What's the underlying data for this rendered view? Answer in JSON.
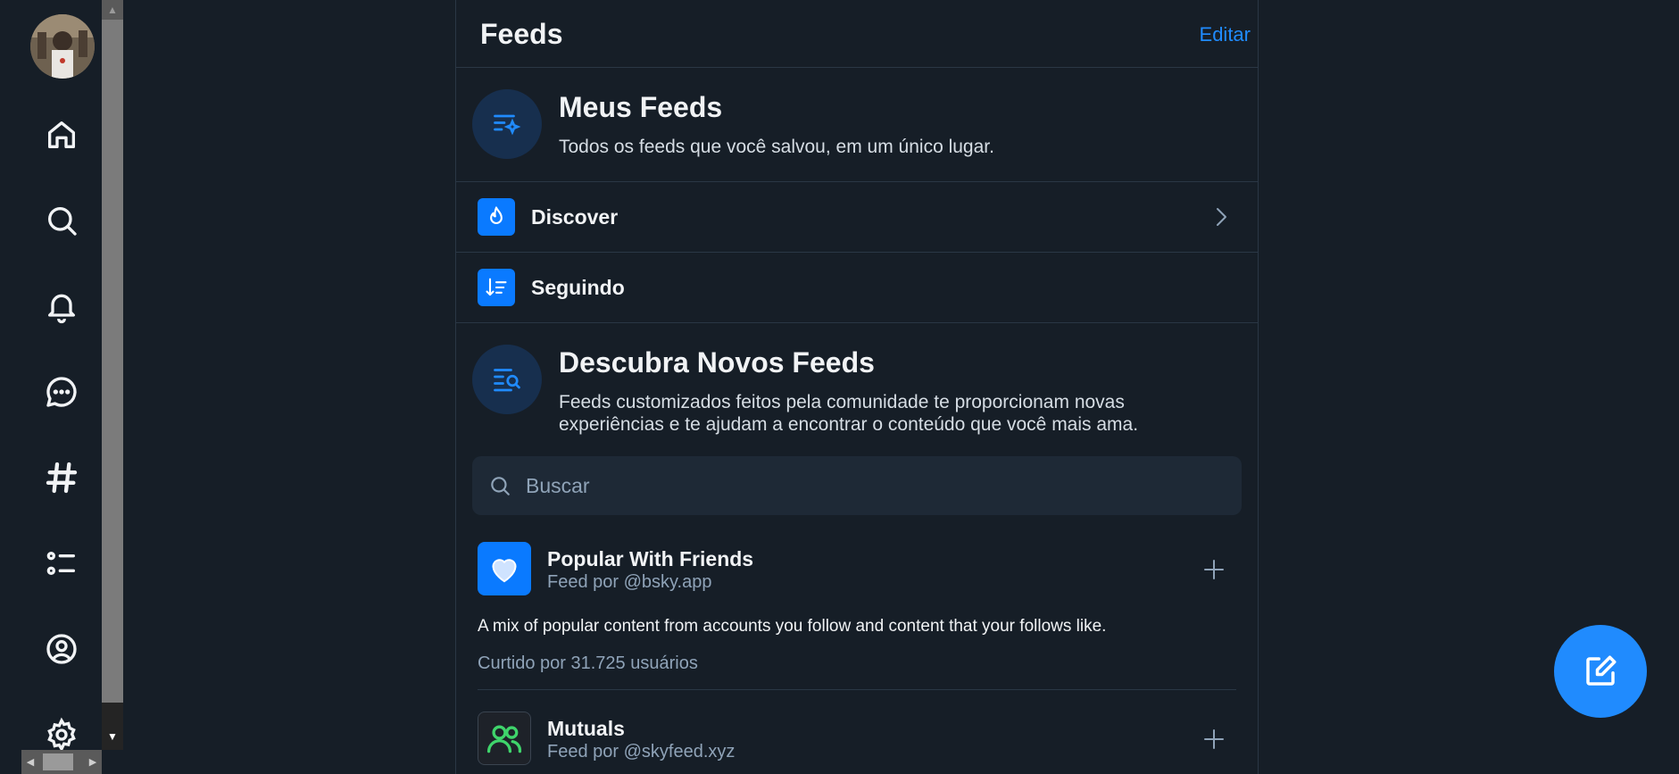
{
  "nav": {
    "items": [
      {
        "name": "home-icon"
      },
      {
        "name": "search-icon"
      },
      {
        "name": "bell-icon"
      },
      {
        "name": "chat-icon"
      },
      {
        "name": "hashtag-icon"
      },
      {
        "name": "list-icon"
      },
      {
        "name": "profile-icon"
      },
      {
        "name": "gear-icon"
      }
    ]
  },
  "header": {
    "title": "Feeds",
    "edit_label": "Editar"
  },
  "my_feeds": {
    "title": "Meus Feeds",
    "description": "Todos os feeds que você salvou, em um único lugar.",
    "rows": [
      {
        "label": "Discover",
        "icon": "flame-icon"
      },
      {
        "label": "Seguindo",
        "icon": "sort-list-icon"
      }
    ]
  },
  "discover": {
    "title": "Descubra Novos Feeds",
    "description_line1": "Feeds customizados feitos pela comunidade te proporcionam novas",
    "description_line2": "experiências e te ajudam a encontrar o conteúdo que você mais ama."
  },
  "search": {
    "placeholder": "Buscar"
  },
  "feeds": [
    {
      "name": "Popular With Friends",
      "by": "Feed por @bsky.app",
      "description": "A mix of popular content from accounts you follow and content that your follows like.",
      "likes": "Curtido por 31.725 usuários",
      "icon": "heart-icon",
      "icon_bg": "#0a7aff"
    },
    {
      "name": "Mutuals",
      "by": "Feed por @skyfeed.xyz",
      "icon": "people-icon",
      "icon_bg": "#1e2229"
    }
  ],
  "colors": {
    "accent": "#208bfe",
    "background": "#161e27",
    "border": "#2a3745",
    "muted": "#8fa3b8"
  }
}
